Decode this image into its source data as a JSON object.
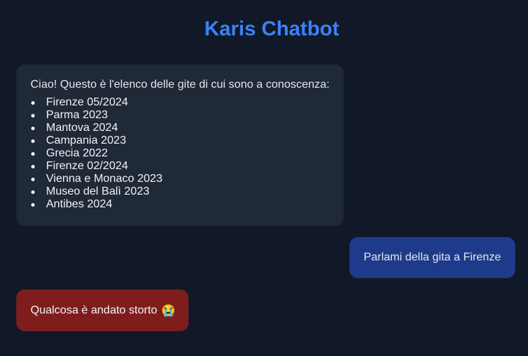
{
  "header": {
    "title": "Karis Chatbot"
  },
  "messages": {
    "bot_intro": "Ciao! Questo è l'elenco delle gite di cui sono a conoscenza:",
    "trips": [
      "Firenze 05/2024",
      "Parma 2023",
      "Mantova 2024",
      "Campania 2023",
      "Grecia 2022",
      "Firenze 02/2024",
      "Vienna e Monaco 2023",
      "Museo del Balì 2023",
      "Antibes 2024"
    ],
    "user_message": "Parlami della gita a Firenze",
    "error_message": "Qualcosa è andato storto",
    "error_emoji": "😭"
  },
  "colors": {
    "background": "#111827",
    "title": "#3b82f6",
    "bot_bubble": "#1f2937",
    "user_bubble": "#1e3a8a",
    "error_bubble": "#7f1d1d"
  }
}
